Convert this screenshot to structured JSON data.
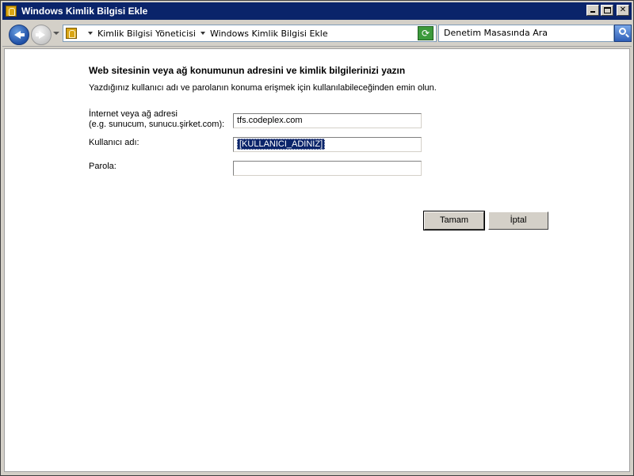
{
  "window": {
    "title": "Windows Kimlik Bilgisi Ekle"
  },
  "navigation": {
    "breadcrumbs": [
      "Kimlik Bilgisi Yöneticisi",
      "Windows Kimlik Bilgisi Ekle"
    ],
    "search_placeholder": "Denetim Masasında Ara"
  },
  "form": {
    "heading": "Web sitesinin veya ağ konumunun adresini ve kimlik bilgilerinizi yazın",
    "description": "Yazdığınız kullanıcı adı ve parolanın konuma erişmek için kullanılabileceğinden emin olun.",
    "address_label_line1": "İnternet veya ağ adresi",
    "address_label_line2": "(e.g. sunucum, sunucu.şirket.com):",
    "address_value": "tfs.codeplex.com",
    "username_label": "Kullanıcı adı:",
    "username_value": "[KULLANICI_ADINIZ]",
    "password_label": "Parola:",
    "password_value": ""
  },
  "buttons": {
    "ok": "Tamam",
    "cancel": "İptal"
  },
  "icons": {
    "window": "credential-vault-icon",
    "back": "back-arrow-icon",
    "forward": "forward-arrow-icon",
    "refresh": "refresh-icon",
    "search": "search-icon"
  },
  "colors": {
    "titlebar": "#0a246a",
    "selection": "#0a246a",
    "back_button": "#1f4fa6",
    "refresh_button": "#3c9a3c"
  }
}
